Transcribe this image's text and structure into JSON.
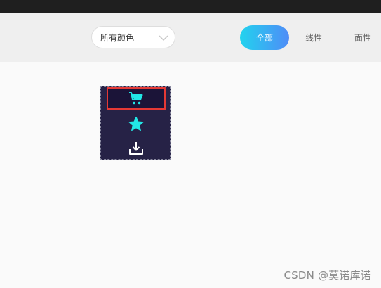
{
  "toolbar": {
    "color_select": {
      "selected": "所有颜色"
    },
    "tabs": [
      {
        "label": "全部",
        "active": true
      },
      {
        "label": "线性",
        "active": false
      },
      {
        "label": "面性",
        "active": false
      }
    ]
  },
  "icon_panel": {
    "icons": [
      {
        "name": "shopping-cart-icon",
        "selected": true
      },
      {
        "name": "star-icon",
        "selected": false
      },
      {
        "name": "download-icon",
        "selected": false
      }
    ]
  },
  "colors": {
    "accent_gradient_start": "#22d3ee",
    "accent_gradient_end": "#4f8cf7",
    "icon_color": "#22e6e6",
    "selection_border": "#e53935",
    "panel_bg": "#262246"
  },
  "watermark": "CSDN @莫诺库诺"
}
